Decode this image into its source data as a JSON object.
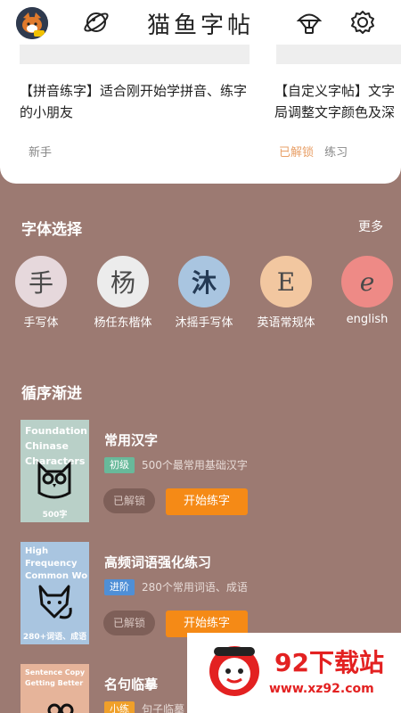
{
  "app": {
    "title": "猫鱼字帖"
  },
  "icons": {
    "avatar": "fox-avatar",
    "explore": "planet-icon",
    "parachute": "parachute-icon",
    "settings": "gear-icon"
  },
  "promos": [
    {
      "text": "【拼音练字】适合刚开始学拼音、练字的小朋友",
      "tag": "新手",
      "status": ""
    },
    {
      "text": "【自定义字帖】文字局调整文字颜色及深",
      "tag": "练习",
      "status": "已解锁"
    }
  ],
  "font_section": {
    "title": "字体选择",
    "more": "更多",
    "items": [
      {
        "glyph": "手",
        "label": "手写体",
        "bg": "#e6d8dc"
      },
      {
        "glyph": "杨",
        "label": "杨任东楷体",
        "bg": "#ececec"
      },
      {
        "glyph": "沐",
        "label": "沐摇手写体",
        "bg": "#a9c5e0"
      },
      {
        "glyph": "E",
        "label": "英语常规体",
        "bg": "#f2c7a0"
      },
      {
        "glyph": "e",
        "label": "english",
        "bg": "#ee8a86"
      }
    ]
  },
  "course_section": {
    "title": "循序渐进",
    "courses": [
      {
        "cover_title": "Foundation Chinase Characters",
        "cover_foot": "500字",
        "cover_bg": "#b9d0c8",
        "title": "常用汉字",
        "level": "初级",
        "level_color": "#68b99a",
        "desc": "500个最常用基础汉字",
        "unlock": "已解锁",
        "start": "开始练字"
      },
      {
        "cover_title": "High Frequency Common Wo",
        "cover_foot": "280+词语、成语",
        "cover_bg": "#a9c5e0",
        "title": "高频词语强化练习",
        "level": "进阶",
        "level_color": "#4f8fd6",
        "desc": "280个常用词语、成语",
        "unlock": "已解锁",
        "start": "开始练字"
      },
      {
        "cover_title": "Sentence Copy Getting Better",
        "cover_foot": "",
        "cover_bg": "#e6b49a",
        "title": "名句临摹",
        "level": "小练",
        "level_color": "#f0a02a",
        "desc": "句子临摹",
        "unlock": "",
        "start": ""
      }
    ]
  },
  "watermark": {
    "text": "92下载站",
    "url": "www.xz92.com"
  }
}
